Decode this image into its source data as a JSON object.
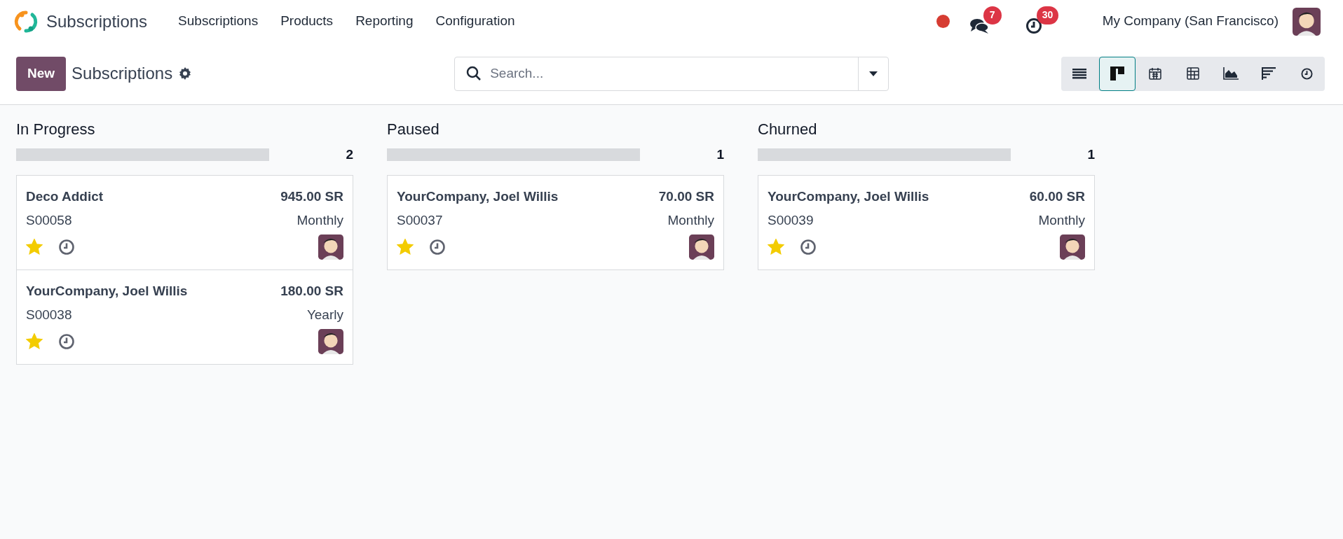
{
  "navbar": {
    "app_name": "Subscriptions",
    "menu": [
      "Subscriptions",
      "Products",
      "Reporting",
      "Configuration"
    ],
    "messages_count": "7",
    "activities_count": "30",
    "company": "My Company (San Francisco)"
  },
  "control_panel": {
    "new_button": "New",
    "title": "Subscriptions",
    "search": {
      "placeholder": "Search..."
    },
    "views": [
      {
        "kind": "list",
        "selected": false
      },
      {
        "kind": "kanban",
        "selected": true
      },
      {
        "kind": "calendar",
        "selected": false
      },
      {
        "kind": "pivot",
        "selected": false
      },
      {
        "kind": "graph",
        "selected": false
      },
      {
        "kind": "cohort",
        "selected": false
      },
      {
        "kind": "activity",
        "selected": false
      }
    ]
  },
  "columns": [
    {
      "title": "In Progress",
      "count": "2",
      "level": 0,
      "cards": [
        {
          "customer": "Deco Addict",
          "amount": "945.00 SR",
          "reference": "S00058",
          "recurrence": "Monthly",
          "starred": true
        },
        {
          "customer": "YourCompany, Joel Willis",
          "amount": "180.00 SR",
          "reference": "S00038",
          "recurrence": "Yearly",
          "starred": true
        }
      ]
    },
    {
      "title": "Paused",
      "count": "1",
      "level": 0,
      "cards": [
        {
          "customer": "YourCompany, Joel Willis",
          "amount": "70.00 SR",
          "reference": "S00037",
          "recurrence": "Monthly",
          "starred": true
        }
      ]
    },
    {
      "title": "Churned",
      "count": "1",
      "level": 0,
      "cards": [
        {
          "customer": "YourCompany, Joel Willis",
          "amount": "60.00 SR",
          "reference": "S00039",
          "recurrence": "Monthly",
          "starred": true
        }
      ]
    }
  ]
}
